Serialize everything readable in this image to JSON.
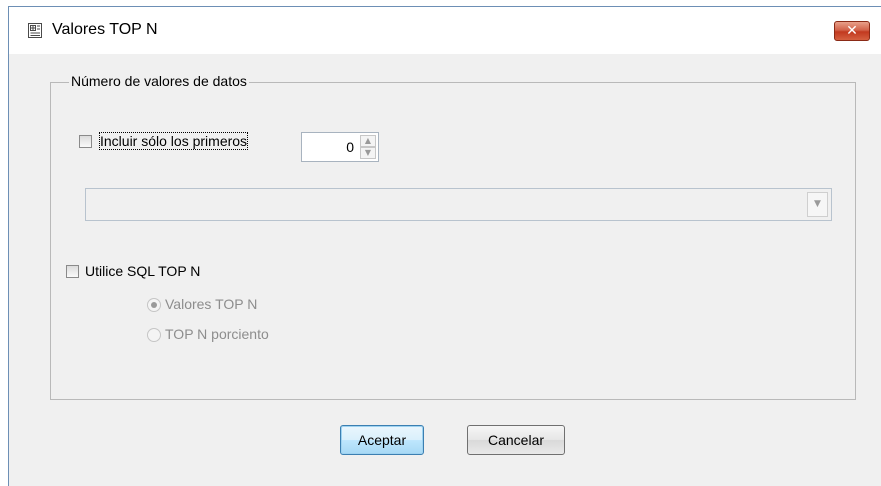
{
  "window": {
    "title": "Valores TOP N",
    "close_symbol": "✕"
  },
  "group": {
    "legend": "Número de valores de datos"
  },
  "include_first": {
    "label": "Incluir sólo los primeros",
    "checked": false,
    "value": "0"
  },
  "combo": {
    "value": ""
  },
  "sql_top_n": {
    "label": "Utilice SQL TOP N",
    "checked": false
  },
  "radios": {
    "top_n_values": "Valores TOP N",
    "top_n_percent": "TOP N porciento"
  },
  "buttons": {
    "accept": "Aceptar",
    "cancel": "Cancelar"
  },
  "icons": {
    "title": "table-dialog-icon",
    "close": "close-icon",
    "spin_up": "chevron-up-icon",
    "spin_down": "chevron-down-icon",
    "combo": "dropdown-arrow-icon"
  },
  "colors": {
    "close_button": "#c7432a",
    "default_button": "#3c7fb1",
    "window_bg": "#f0f0f0"
  }
}
